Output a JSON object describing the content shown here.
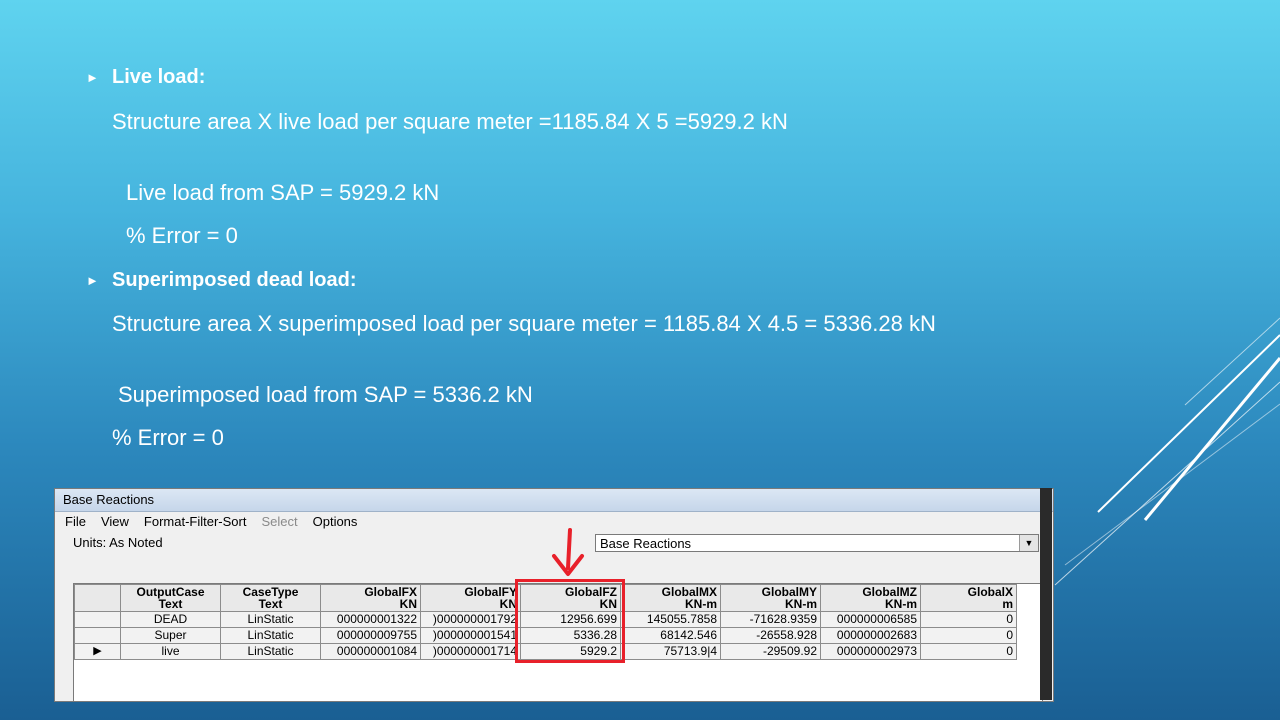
{
  "slide": {
    "bullet1": {
      "heading": "Live load:",
      "line1": "Structure area X live load per square meter =1185.84 X 5 =5929.2 kN",
      "line2": "Live load from SAP = 5929.2 kN",
      "line3": "% Error = 0"
    },
    "bullet2": {
      "heading": "Superimposed dead load:",
      "line1": "Structure area X superimposed load per square meter = 1185.84 X 4.5 = 5336.28 kN",
      "line2": "Superimposed load from SAP = 5336.2 kN",
      "line3": "% Error = 0"
    },
    "bullet_icon": "triangle-right-icon"
  },
  "window": {
    "title": "Base Reactions",
    "menu": [
      "File",
      "View",
      "Format-Filter-Sort",
      "Select",
      "Options"
    ],
    "units_label": "Units:  As Noted",
    "dropdown_value": "Base Reactions",
    "columns": [
      {
        "name": "OutputCase",
        "unit": "Text"
      },
      {
        "name": "CaseType",
        "unit": "Text"
      },
      {
        "name": "GlobalFX",
        "unit": "KN"
      },
      {
        "name": "GlobalFY",
        "unit": "KN"
      },
      {
        "name": "GlobalFZ",
        "unit": "KN"
      },
      {
        "name": "GlobalMX",
        "unit": "KN-m"
      },
      {
        "name": "GlobalMY",
        "unit": "KN-m"
      },
      {
        "name": "GlobalMZ",
        "unit": "KN-m"
      },
      {
        "name": "GlobalX",
        "unit": "m"
      }
    ],
    "rows": [
      [
        "DEAD",
        "LinStatic",
        "000000001322",
        ")000000001792",
        "12956.699",
        "145055.7858",
        "-71628.9359",
        "000000006585",
        "0"
      ],
      [
        "Super",
        "LinStatic",
        "000000009755",
        ")000000001541",
        "5336.28",
        "68142.546",
        "-26558.928",
        "000000002683",
        "0"
      ],
      [
        "live",
        "LinStatic",
        "000000001084",
        ")000000001714",
        "5929.2",
        "75713.9|4",
        "-29509.92",
        "000000002973",
        "0"
      ]
    ],
    "row_pointer": "▶"
  },
  "colors": {
    "highlight": "#e8202a",
    "bg_top": "#5fd3ef",
    "bg_bottom": "#1a5f93"
  }
}
